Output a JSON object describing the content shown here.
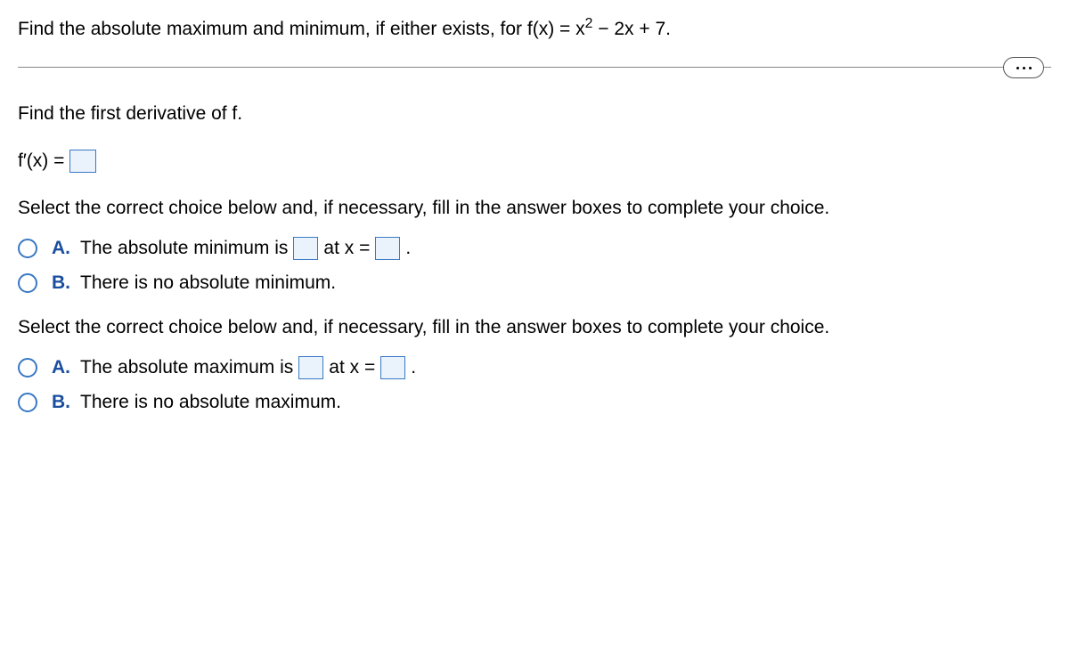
{
  "question": {
    "prefix": "Find the absolute maximum and minimum, if either exists, for f(x) = x",
    "exp": "2",
    "suffix": " − 2x + 7."
  },
  "derivative": {
    "instruction": "Find the first derivative of f.",
    "label": "f′(x) ="
  },
  "select_instruction": "Select the correct choice below and, if necessary, fill in the answer boxes to complete your choice.",
  "min_group": {
    "A": {
      "label": "A.",
      "part1": "The absolute minimum is",
      "part2": "at x =",
      "part3": "."
    },
    "B": {
      "label": "B.",
      "text": "There is no absolute minimum."
    }
  },
  "max_group": {
    "A": {
      "label": "A.",
      "part1": "The absolute maximum is",
      "part2": "at x =",
      "part3": "."
    },
    "B": {
      "label": "B.",
      "text": "There is no absolute maximum."
    }
  }
}
